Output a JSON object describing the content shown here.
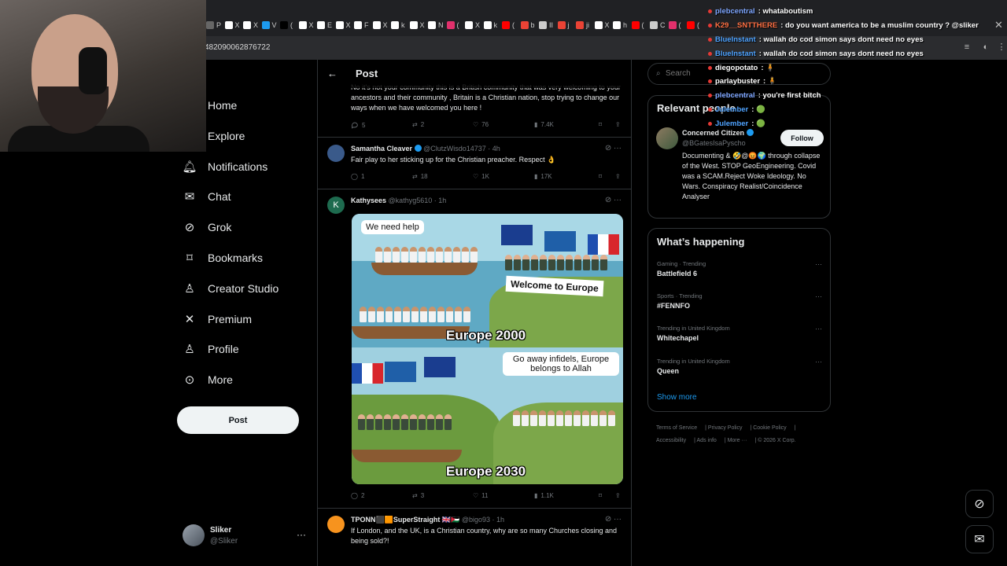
{
  "browser": {
    "url": "482090062876722",
    "tabs": [
      "P",
      "X",
      "X",
      "V",
      "(",
      "X",
      "E",
      "X",
      "F",
      "X",
      "k",
      "X",
      "N",
      "(",
      "X",
      "k",
      "(",
      "b",
      "II",
      "j",
      "ji",
      "X",
      "h",
      "(",
      "C",
      "(",
      "("
    ]
  },
  "nav": {
    "items": [
      {
        "label": "Home",
        "icon": "home-icon"
      },
      {
        "label": "Explore",
        "icon": "search-icon"
      },
      {
        "label": "Notifications",
        "icon": "bell-icon"
      },
      {
        "label": "Chat",
        "icon": "envelope-icon"
      },
      {
        "label": "Grok",
        "icon": "grok-icon"
      },
      {
        "label": "Bookmarks",
        "icon": "bookmark-icon"
      },
      {
        "label": "Creator Studio",
        "icon": "creator-icon"
      },
      {
        "label": "Premium",
        "icon": "x-icon"
      },
      {
        "label": "Profile",
        "icon": "person-icon"
      },
      {
        "label": "More",
        "icon": "more-circle-icon"
      }
    ],
    "post_button": "Post",
    "account": {
      "name": "Sliker",
      "handle": "@Sliker"
    }
  },
  "center": {
    "header_title": "Post",
    "top_reply": {
      "text": "No it's not your community this is a British community that was very welcoming to your ancestors and their community , Britain is a Christian nation, stop trying to change our ways when we have welcomed you here !",
      "replies": "5",
      "reposts": "2",
      "likes": "76",
      "views": "7.4K"
    },
    "tweets": [
      {
        "name": "Samantha Cleaver",
        "handle": "@ClutzWisdo14737",
        "time": "· 4h",
        "text": "Fair play to her sticking up for the Christian preacher. Respect 👌",
        "replies": "1",
        "reposts": "18",
        "likes": "1K",
        "views": "17K"
      },
      {
        "name": "Kathysees",
        "handle": "@kathyg5610",
        "time": "· 1h",
        "avatar_letter": "K",
        "replies": "2",
        "reposts": "3",
        "likes": "11",
        "views": "1.1K",
        "meme": {
          "bubble_top": "We need help",
          "banner": "Welcome to Europe",
          "caption_top": "Europe 2000",
          "bubble_bottom": "Go away infidels, Europe belongs to Allah",
          "caption_bottom": "Europe 2030"
        }
      },
      {
        "name": "TPONN⬛🟧SuperStraight 🇬🇧🇯🇴",
        "handle": "@bigo93",
        "time": "· 1h",
        "text": "If London, and the UK, is a Christian country, why are so many Churches closing and being sold?!"
      }
    ]
  },
  "right": {
    "search_placeholder": "Search",
    "relevant_title": "Relevant people",
    "person": {
      "name": "Concerned Citizen",
      "handle": "@BGatesIsaPyscho",
      "follow": "Follow",
      "bio": "Documenting & 🤣@😡🌍 through collapse of the West. STOP GeoEngineering. Covid was a SCAM.Reject Woke Ideology. No Wars. Conspiracy Realist/Coincidence Analyser"
    },
    "happening_title": "What’s happening",
    "trends": [
      {
        "context": "Gaming · Trending",
        "topic": "Battlefield 6"
      },
      {
        "context": "Sports · Trending",
        "topic": "#FENNFO"
      },
      {
        "context": "Trending in United Kingdom",
        "topic": "Whitechapel"
      },
      {
        "context": "Trending in United Kingdom",
        "topic": "Queen"
      }
    ],
    "show_more": "Show more",
    "footer": [
      "Terms of Service",
      "Privacy Policy",
      "Cookie Policy",
      "Accessibility",
      "Ads info",
      "More ···",
      "© 2026 X Corp."
    ]
  },
  "chat": [
    {
      "user": "plebcentral",
      "msg": ": whataboutism",
      "color": "#7ea6ff"
    },
    {
      "user": "K29__SNTTHERE",
      "msg": ": do you want america to be a muslim country ? @sliker",
      "color": "#ff7043"
    },
    {
      "user": "BlueInstant",
      "msg": ": wallah do cod simon says dont need no eyes",
      "color": "#4fa3ff"
    },
    {
      "user": "BlueInstant",
      "msg": ": wallah do cod simon says dont need no eyes",
      "color": "#4fa3ff"
    },
    {
      "user": "diegopotato",
      "msg": ": 🧍",
      "color": "#ffffff"
    },
    {
      "user": "parlaybuster",
      "msg": ": 🧍",
      "color": "#ffffff"
    },
    {
      "user": "plebcentral",
      "msg": ": you're first bitch",
      "color": "#7ea6ff"
    },
    {
      "user": "Julember",
      "msg": ": 🟢",
      "color": "#4fa3ff"
    },
    {
      "user": "Julember",
      "msg": ": 🟢",
      "color": "#4fa3ff"
    }
  ],
  "colors": {
    "accent": "#1d9bf0",
    "border": "#2f3336",
    "muted": "#71767b"
  }
}
